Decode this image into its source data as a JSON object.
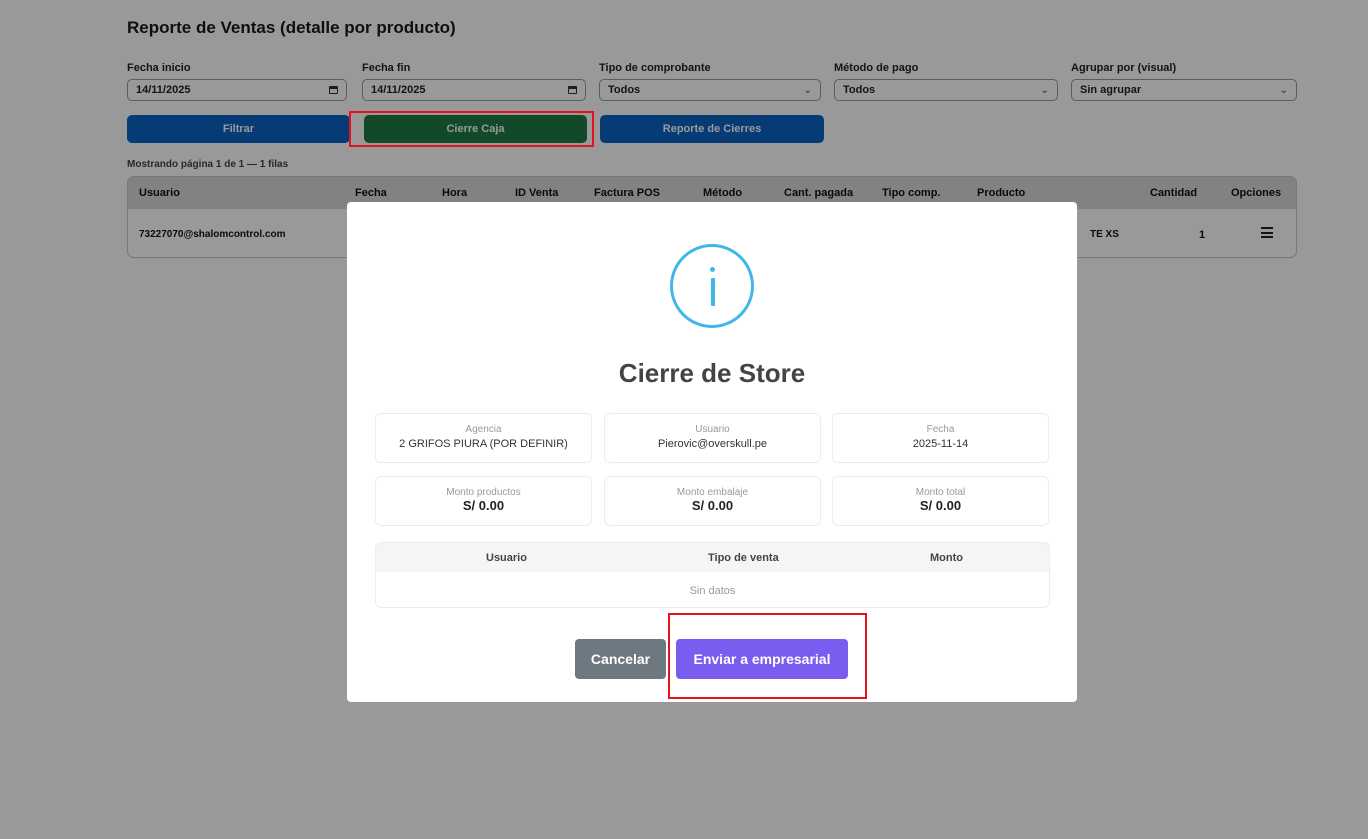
{
  "page": {
    "title": "Reporte de Ventas (detalle por producto)",
    "filters": [
      {
        "label": "Fecha inicio",
        "value": "14/11/2025",
        "icon": "calendar-icon"
      },
      {
        "label": "Fecha fin",
        "value": "14/11/2025",
        "icon": "calendar-icon"
      },
      {
        "label": "Tipo de comprobante",
        "value": "Todos",
        "icon": "chevron-down-icon"
      },
      {
        "label": "Método de pago",
        "value": "Todos",
        "icon": "chevron-down-icon"
      },
      {
        "label": "Agrupar por (visual)",
        "value": "Sin agrupar",
        "icon": "chevron-down-icon"
      }
    ],
    "buttons": {
      "filter": "Filtrar",
      "close_cash": "Cierre Caja",
      "closures_report": "Reporte de Cierres"
    },
    "pagination": "Mostrando página 1 de 1 — 1 filas",
    "table": {
      "headers": [
        "Usuario",
        "Fecha",
        "Hora",
        "ID Venta",
        "Factura POS",
        "Método",
        "Cant. pagada",
        "Tipo comp.",
        "Producto",
        "Cantidad",
        "Opciones"
      ],
      "row": {
        "usuario": "73227070@shalomcontrol.com",
        "producto": "TE XS",
        "cantidad": "1"
      }
    }
  },
  "modal": {
    "title": "Cierre de Store",
    "cards": [
      {
        "label": "Agencia",
        "value": "2 GRIFOS PIURA (POR DEFINIR)"
      },
      {
        "label": "Usuario",
        "value": "Pierovic@overskull.pe"
      },
      {
        "label": "Fecha",
        "value": "2025-11-14"
      },
      {
        "label": "Monto productos",
        "value": "S/ 0.00"
      },
      {
        "label": "Monto embalaje",
        "value": "S/ 0.00"
      },
      {
        "label": "Monto total",
        "value": "S/ 0.00"
      }
    ],
    "table": {
      "headers": [
        "Usuario",
        "Tipo de venta",
        "Monto"
      ],
      "empty": "Sin datos"
    },
    "buttons": {
      "cancel": "Cancelar",
      "send": "Enviar a empresarial"
    }
  },
  "colors": {
    "primary_blue": "#0b63c5",
    "close_green": "#1e7a44",
    "send_purple": "#7a5cf0",
    "cancel_gray": "#6e7881",
    "info_cyan": "#3fb7ea",
    "highlight_red": "#e3121b"
  }
}
